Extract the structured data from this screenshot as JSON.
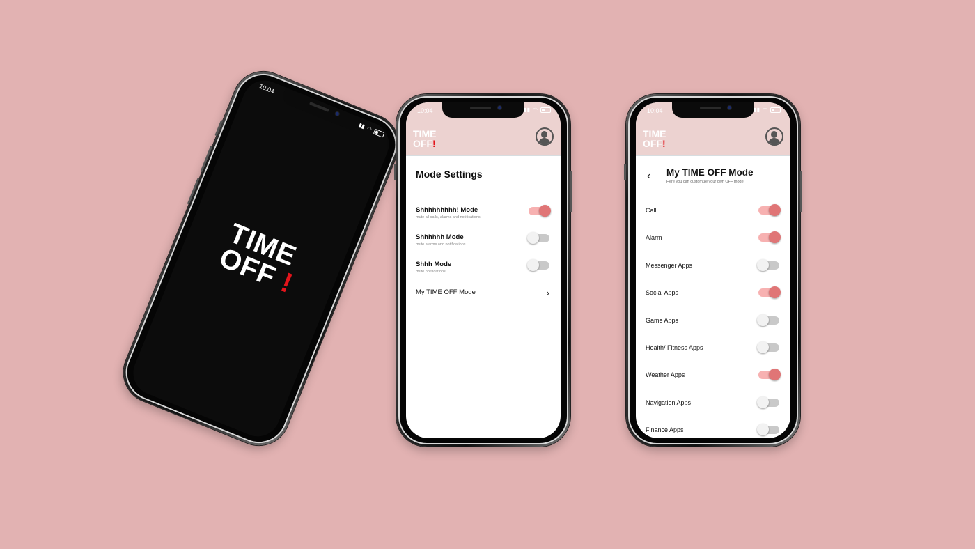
{
  "status_bar": {
    "time": "10:04",
    "signal_icon": "signal-icon",
    "wifi_icon": "wifi-icon",
    "battery_icon": "battery-icon"
  },
  "brand": {
    "line1": "TIME",
    "line2": "OFF",
    "bang": "!",
    "accent": "#e3141b",
    "header_bg": "#ecd2d0",
    "toggle_on": "#e07576",
    "page_bg": "#e2b2b2"
  },
  "splash": {
    "line1": "TIME",
    "line2": "OFF",
    "bang": "!"
  },
  "mode_settings": {
    "title": "Mode Settings",
    "modes": [
      {
        "label": "Shhhhhhhhh! Mode",
        "desc": "mute all calls, alarms and notifications",
        "on": true
      },
      {
        "label": "Shhhhhh Mode",
        "desc": "mute alarms and notifications",
        "on": false
      },
      {
        "label": "Shhh Mode",
        "desc": "mute notifications",
        "on": false
      }
    ],
    "custom_link": {
      "label": "My TIME OFF Mode",
      "chevron": "›"
    }
  },
  "my_mode": {
    "back": "‹",
    "title": "My TIME OFF Mode",
    "subtitle": "Here you can customize your own OFF mode",
    "items": [
      {
        "label": "Call",
        "on": true
      },
      {
        "label": "Alarm",
        "on": true
      },
      {
        "label": "Messenger Apps",
        "on": false
      },
      {
        "label": "Social Apps",
        "on": true
      },
      {
        "label": "Game Apps",
        "on": false
      },
      {
        "label": "Health/ Fitness Apps",
        "on": false
      },
      {
        "label": "Weather Apps",
        "on": true
      },
      {
        "label": "Navigation Apps",
        "on": false
      },
      {
        "label": "Finance Apps",
        "on": false
      }
    ]
  }
}
